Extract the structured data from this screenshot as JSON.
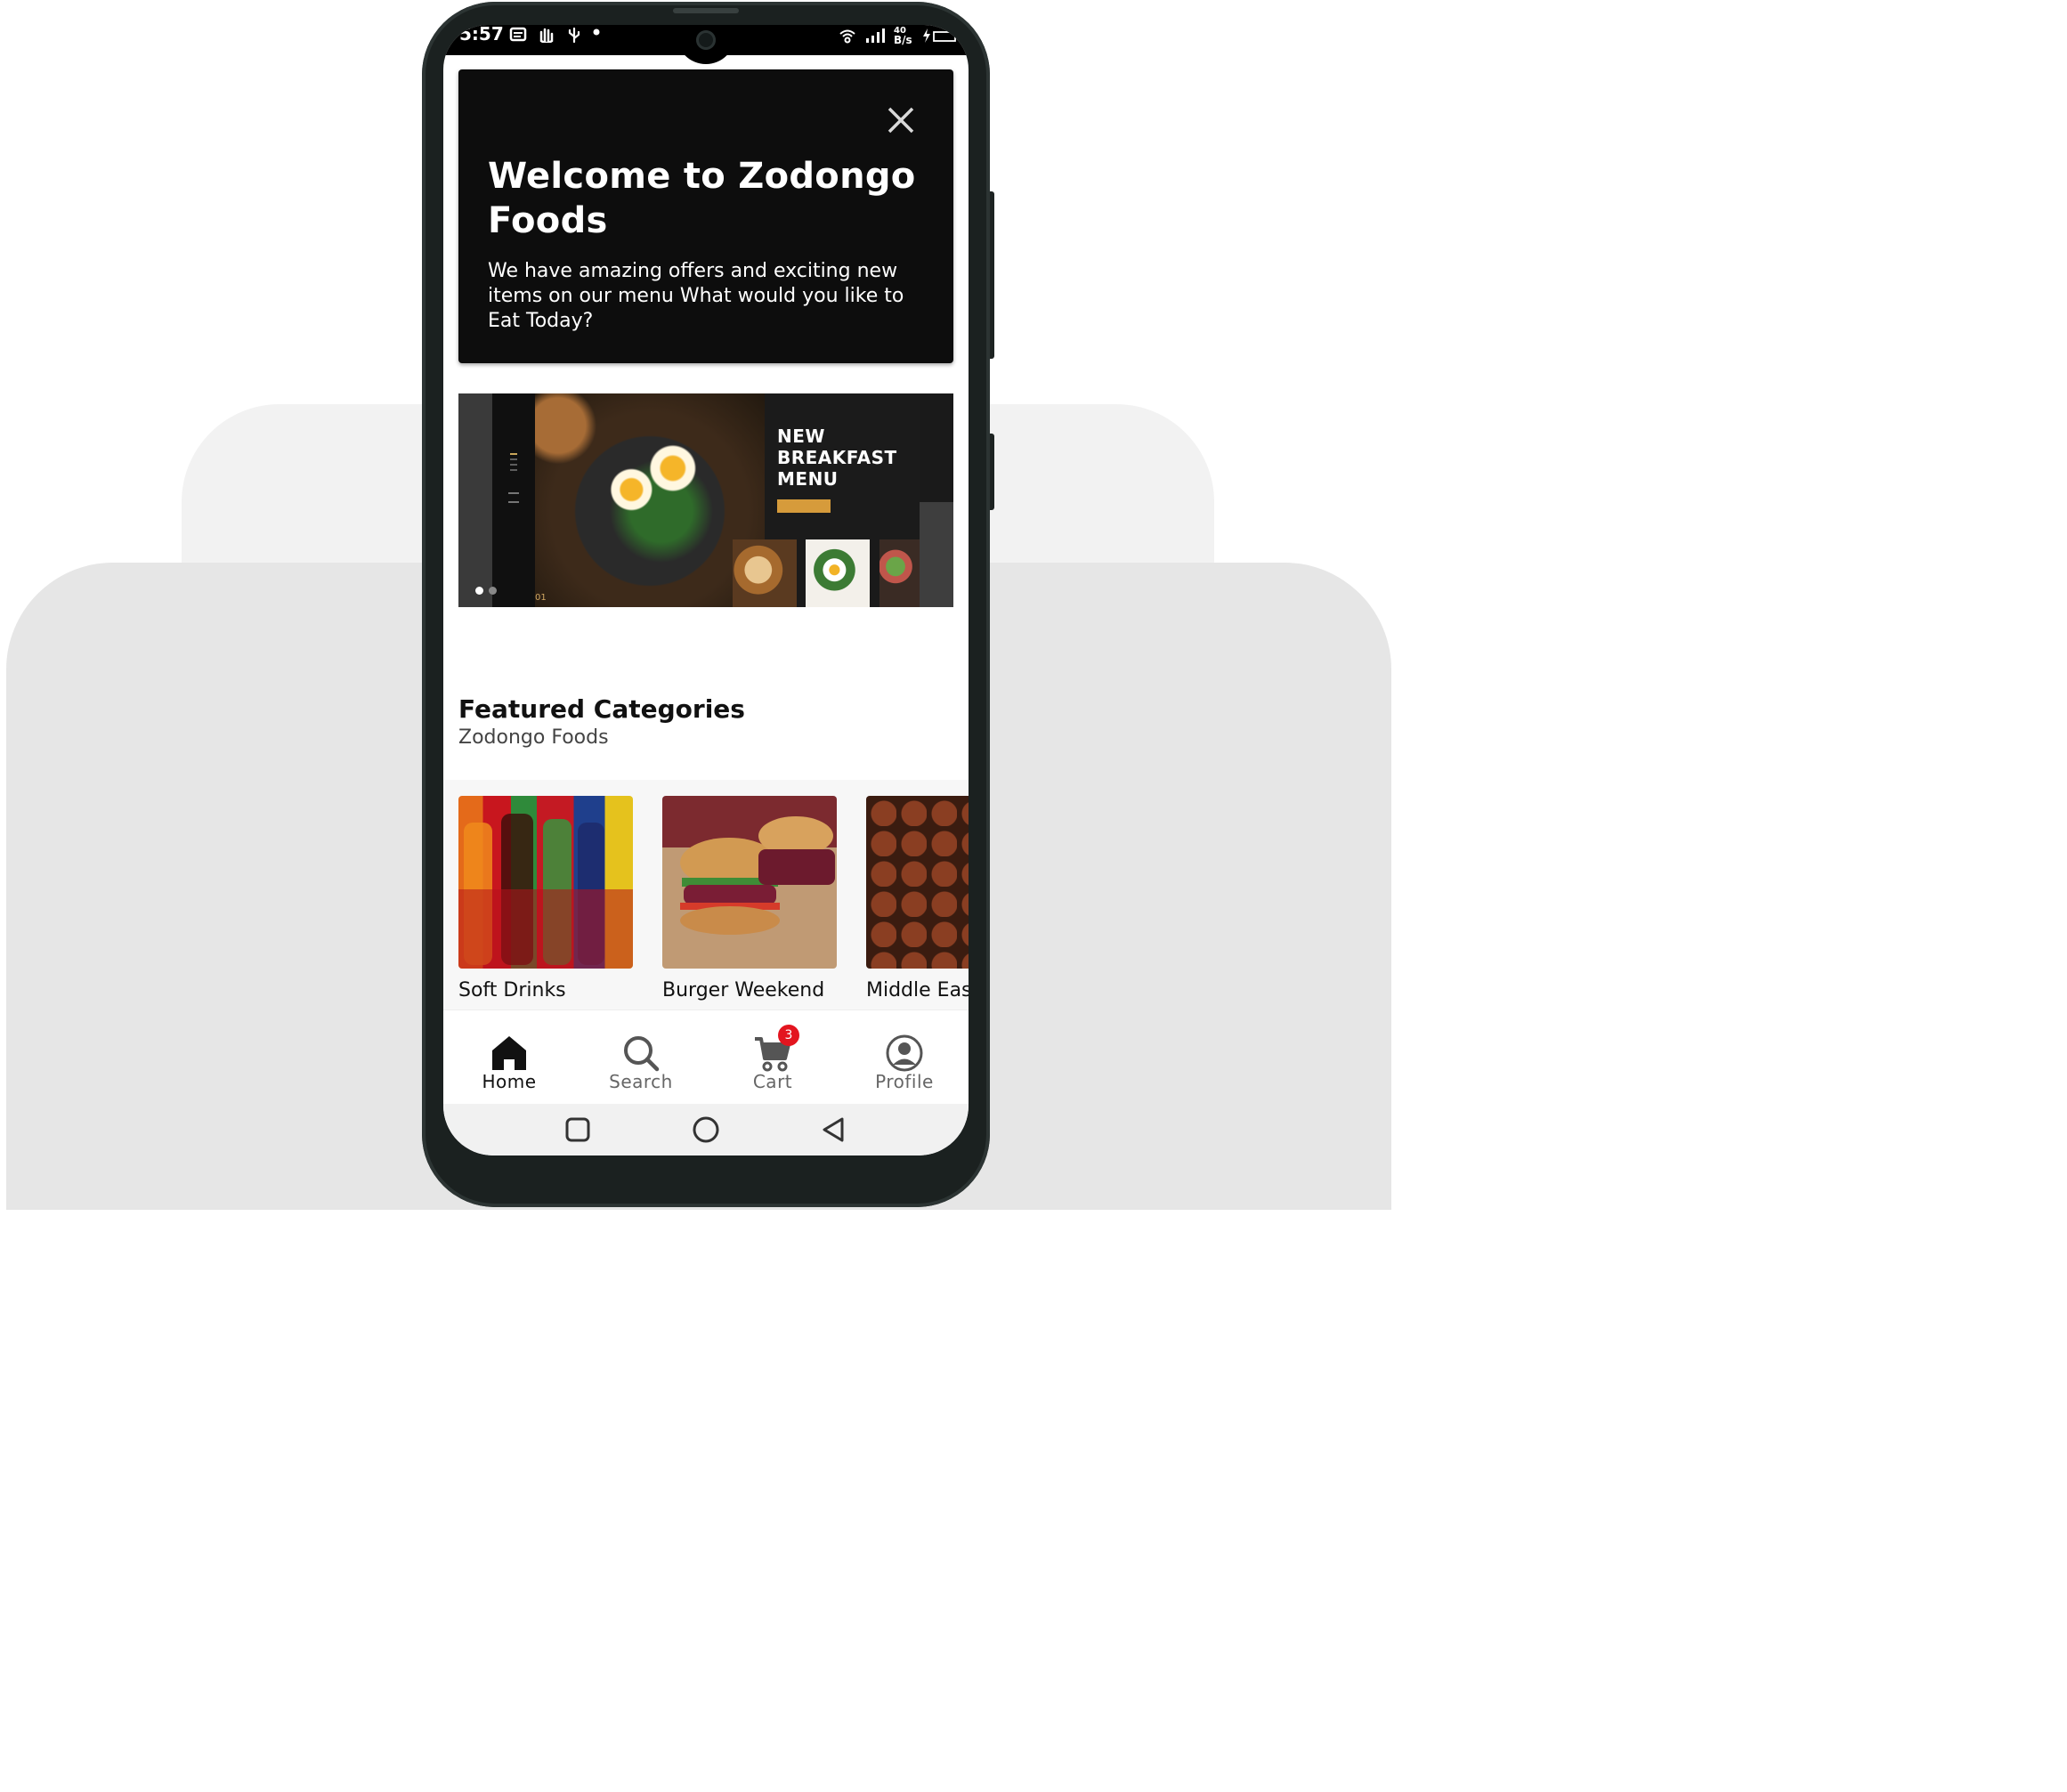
{
  "statusbar": {
    "time": "5:57",
    "speed_line1": "40",
    "speed_line2": "B/s"
  },
  "welcome": {
    "title": "Welcome to Zodongo Foods",
    "text": "We have amazing offers and exciting new items on our menu What would you like to Eat Today?"
  },
  "banner": {
    "headline": "NEW BREAKFAST MENU",
    "page_indicator": "01",
    "slides": 2,
    "active_slide": 1
  },
  "featured": {
    "title": "Featured Categories",
    "subtitle": "Zodongo Foods",
    "categories": [
      {
        "label": "Soft Drinks"
      },
      {
        "label": "Burger Weekend"
      },
      {
        "label": "Middle East"
      }
    ]
  },
  "nav": {
    "tabs": [
      {
        "label": "Home",
        "icon": "home-icon",
        "active": true
      },
      {
        "label": "Search",
        "icon": "search-icon"
      },
      {
        "label": "Cart",
        "icon": "cart-icon",
        "badge": "3"
      },
      {
        "label": "Profile",
        "icon": "profile-icon"
      }
    ]
  },
  "colors": {
    "card_bg": "#0d0d0d",
    "badge": "#e3151f",
    "banner_button": "#d69b3b"
  }
}
